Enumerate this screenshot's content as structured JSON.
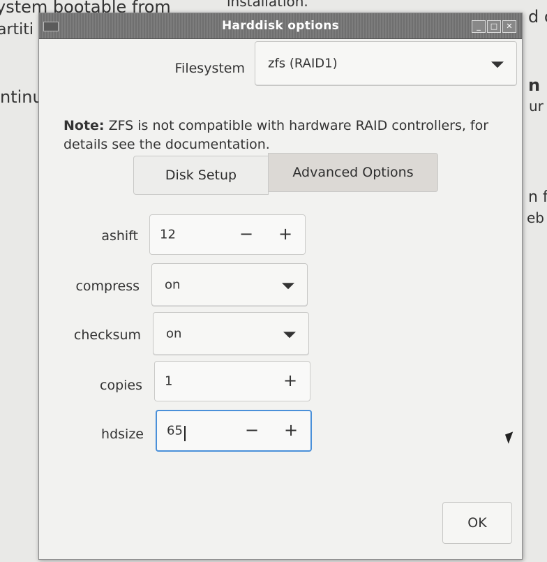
{
  "background": {
    "line1": "ystem bootable from",
    "line2": "installation.",
    "line3": "artiti",
    "line4": "d c",
    "line5": "ntinu",
    "line6": "n",
    "line7": "ur",
    "line8": "n f",
    "line9": "eb"
  },
  "window": {
    "title": "Harddisk options",
    "buttons": [
      "minimize",
      "maximize",
      "close"
    ]
  },
  "filesystem": {
    "label": "Filesystem",
    "value": "zfs (RAID1)"
  },
  "note": {
    "bold": "Note:",
    "text": " ZFS is not compatible with hardware RAID controllers, for details see the documentation."
  },
  "tabs": {
    "disk_setup": "Disk Setup",
    "advanced": "Advanced Options"
  },
  "fields": {
    "ashift": {
      "label": "ashift",
      "value": "12",
      "minus": "−",
      "plus": "+"
    },
    "compress": {
      "label": "compress",
      "value": "on"
    },
    "checksum": {
      "label": "checksum",
      "value": "on"
    },
    "copies": {
      "label": "copies",
      "value": "1",
      "plus": "+"
    },
    "hdsize": {
      "label": "hdsize",
      "value": "65",
      "minus": "−",
      "plus": "+"
    }
  },
  "ok_label": "OK",
  "colors": {
    "titlebar": "#747474",
    "focus": "#4a90d9",
    "active_tab": "#dcd9d5"
  }
}
